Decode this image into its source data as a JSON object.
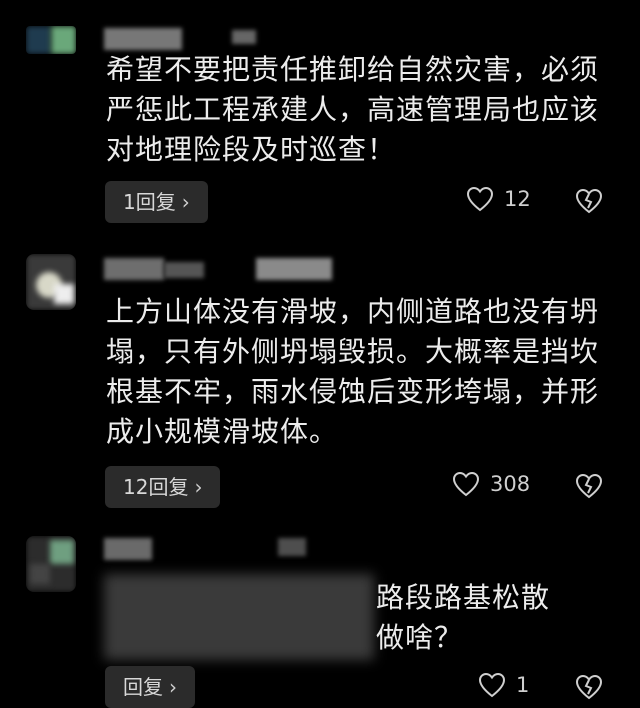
{
  "comments": [
    {
      "text": "希望不要把责任推卸给自然灾害，必须\n严惩此工程承建人，高速管理局也应该\n对地理险段及时巡查！",
      "reply_label": "1回复",
      "like_count": "12"
    },
    {
      "text": "上方山体没有滑坡，内侧道路也没有坍\n塌，只有外侧坍塌毁损。大概率是挡坎\n根基不牢，雨水侵蚀后变形垮塌，并形\n成小规模滑坡体。",
      "reply_label": "12回复",
      "like_count": "308"
    },
    {
      "text": "路段路基松散\n做啥？",
      "reply_label": "回复",
      "like_count": "1"
    }
  ],
  "icons": {
    "like": "heart-outline-icon",
    "dislike": "broken-heart-icon",
    "reply_chevron": "chevron-right-icon"
  },
  "colors": {
    "background": "#000000",
    "text": "#ececec",
    "button_bg": "#2b2b2b"
  }
}
